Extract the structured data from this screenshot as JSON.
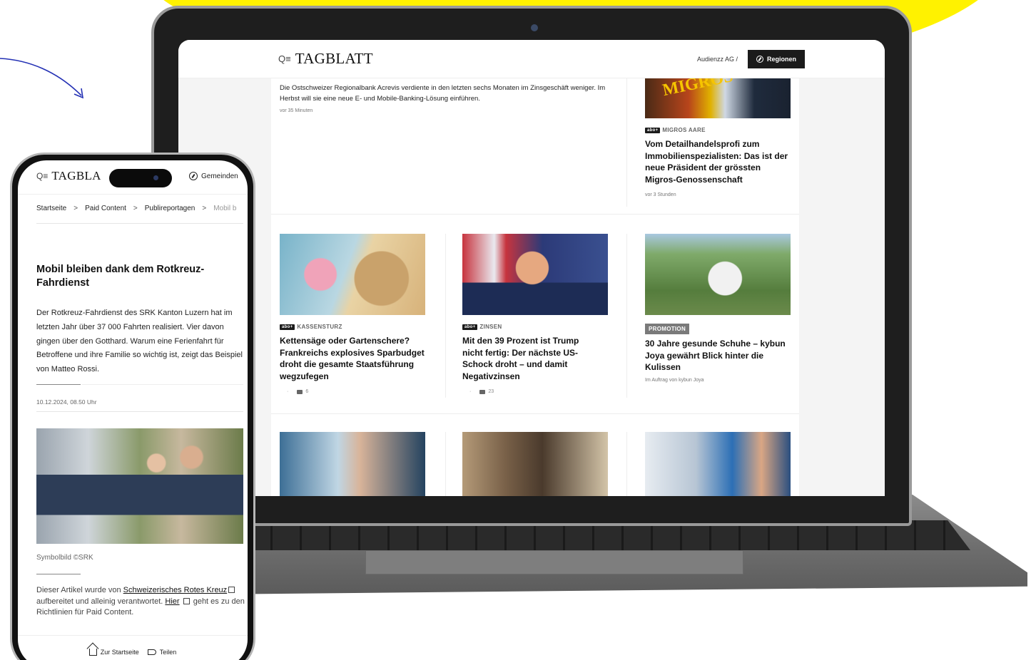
{
  "colors": {
    "accent_yellow": "#fff200",
    "arrow_blue": "#2330b4",
    "dark": "#1b1b1b"
  },
  "laptop": {
    "header": {
      "brand_glyph": "Q≡",
      "brand": "TAGBLATT",
      "audienzz": "Audienzz AG /",
      "regionen_label": "Regionen"
    },
    "top_article": {
      "lead": "Die Ostschweizer Regionalbank Acrevis verdiente in den letzten sechs Monaten im Zinsgeschäft weniger. Im Herbst will sie eine neue E- und Mobile-Banking-Lösung einführen.",
      "meta": "vor 35 Minuten"
    },
    "migros_article": {
      "image_text": "MIGROS",
      "badge": "abo+",
      "kicker": "MIGROS AARE",
      "headline": "Vom Detailhandelsprofi zum Immobilienspezialisten: Das ist der neue Präsident der grössten Migros-Genossenschaft",
      "meta": "vor 3 Stunden"
    },
    "cards": [
      {
        "badge": "abo+",
        "kicker": "KASSENSTURZ",
        "headline": "Kettensäge oder Gartenschere? Frankreichs explosives Sparbudget droht die gesamte Staatsführung wegzufegen",
        "dot": "·",
        "comments": "6"
      },
      {
        "badge": "abo+",
        "kicker": "ZINSEN",
        "headline": "Mit den 39 Prozent ist Trump nicht fertig: Der nächste US-Schock droht – und damit Negativzinsen",
        "dot": "·",
        "comments": "23"
      },
      {
        "promo": "PROMOTION",
        "headline": "30 Jahre gesunde Schuhe – kybun Joya gewährt Blick hinter die Kulissen",
        "meta": "Im Auftrag von kybun Joya"
      }
    ]
  },
  "phone": {
    "brand_glyph": "Q≡",
    "brand": "TAGBLA",
    "gemeinden": "Gemeinden",
    "breadcrumb": [
      "Startseite",
      "Paid Content",
      "Publireportagen",
      "Mobil b"
    ],
    "crumb_separator": ">",
    "title": "Mobil bleiben dank dem Rotkreuz-Fahrdienst",
    "lead": "Der Rotkreuz-Fahrdienst des SRK Kanton Luzern hat im letzten Jahr über 37 000 Fahrten realisiert. Vier davon gingen über den Gotthard. Warum eine Ferienfahrt für Betroffene und ihre Familie so wichtig ist, zeigt das Beispiel von Matteo Rossi.",
    "date": "10.12.2024, 08.50 Uhr",
    "caption": "Symbolbild ©SRK",
    "disclaimer_prefix": "Dieser Artikel wurde von",
    "disclaimer_link1": "Schweizerisches Rotes Kreuz",
    "disclaimer_middle": "aufbereitet und alleinig verantwortet.",
    "disclaimer_link2": "Hier",
    "disclaimer_suffix": "geht es zu den Richtlinien für Paid Content.",
    "footer_home": "Zur Startseite",
    "footer_share": "Teilen"
  }
}
